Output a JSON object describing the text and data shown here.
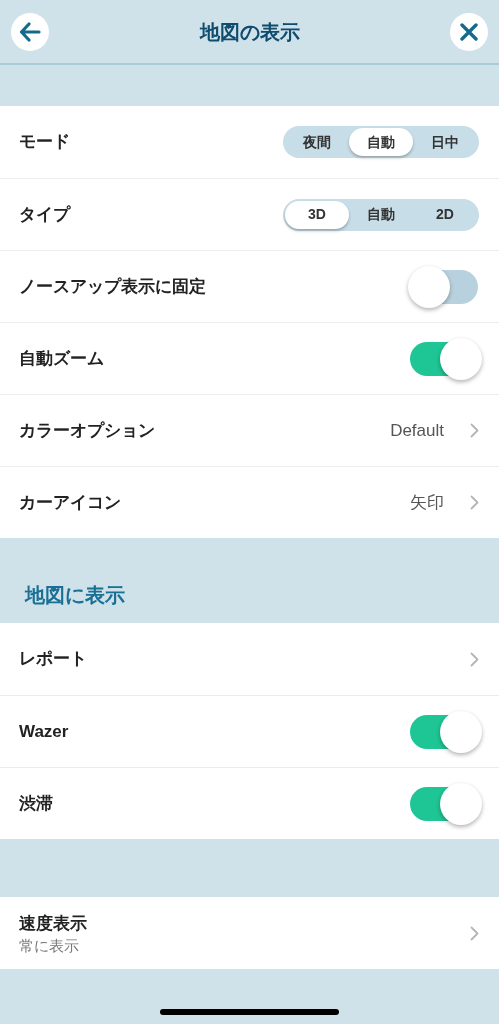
{
  "header": {
    "title": "地図の表示"
  },
  "sections": [
    {
      "rows": [
        {
          "kind": "segmented",
          "label": "モード",
          "options": [
            {
              "label": "夜間",
              "selected": false
            },
            {
              "label": "自動",
              "selected": true
            },
            {
              "label": "日中",
              "selected": false
            }
          ]
        },
        {
          "kind": "segmented",
          "label": "タイプ",
          "options": [
            {
              "label": "3D",
              "selected": true
            },
            {
              "label": "自動",
              "selected": false
            },
            {
              "label": "2D",
              "selected": false
            }
          ]
        },
        {
          "kind": "toggle",
          "label": "ノースアップ表示に固定",
          "on": false
        },
        {
          "kind": "toggle",
          "label": "自動ズーム",
          "on": true
        },
        {
          "kind": "link",
          "label": "カラーオプション",
          "value": "Default"
        },
        {
          "kind": "link",
          "label": "カーアイコン",
          "value": "矢印"
        }
      ]
    },
    {
      "title": "地図に表示",
      "rows": [
        {
          "kind": "link",
          "label": "レポート"
        },
        {
          "kind": "toggle",
          "label": "Wazer",
          "on": true
        },
        {
          "kind": "toggle",
          "label": "渋滞",
          "on": true
        }
      ]
    },
    {
      "rows": [
        {
          "kind": "link",
          "label": "速度表示",
          "subtitle": "常に表示"
        }
      ]
    }
  ]
}
